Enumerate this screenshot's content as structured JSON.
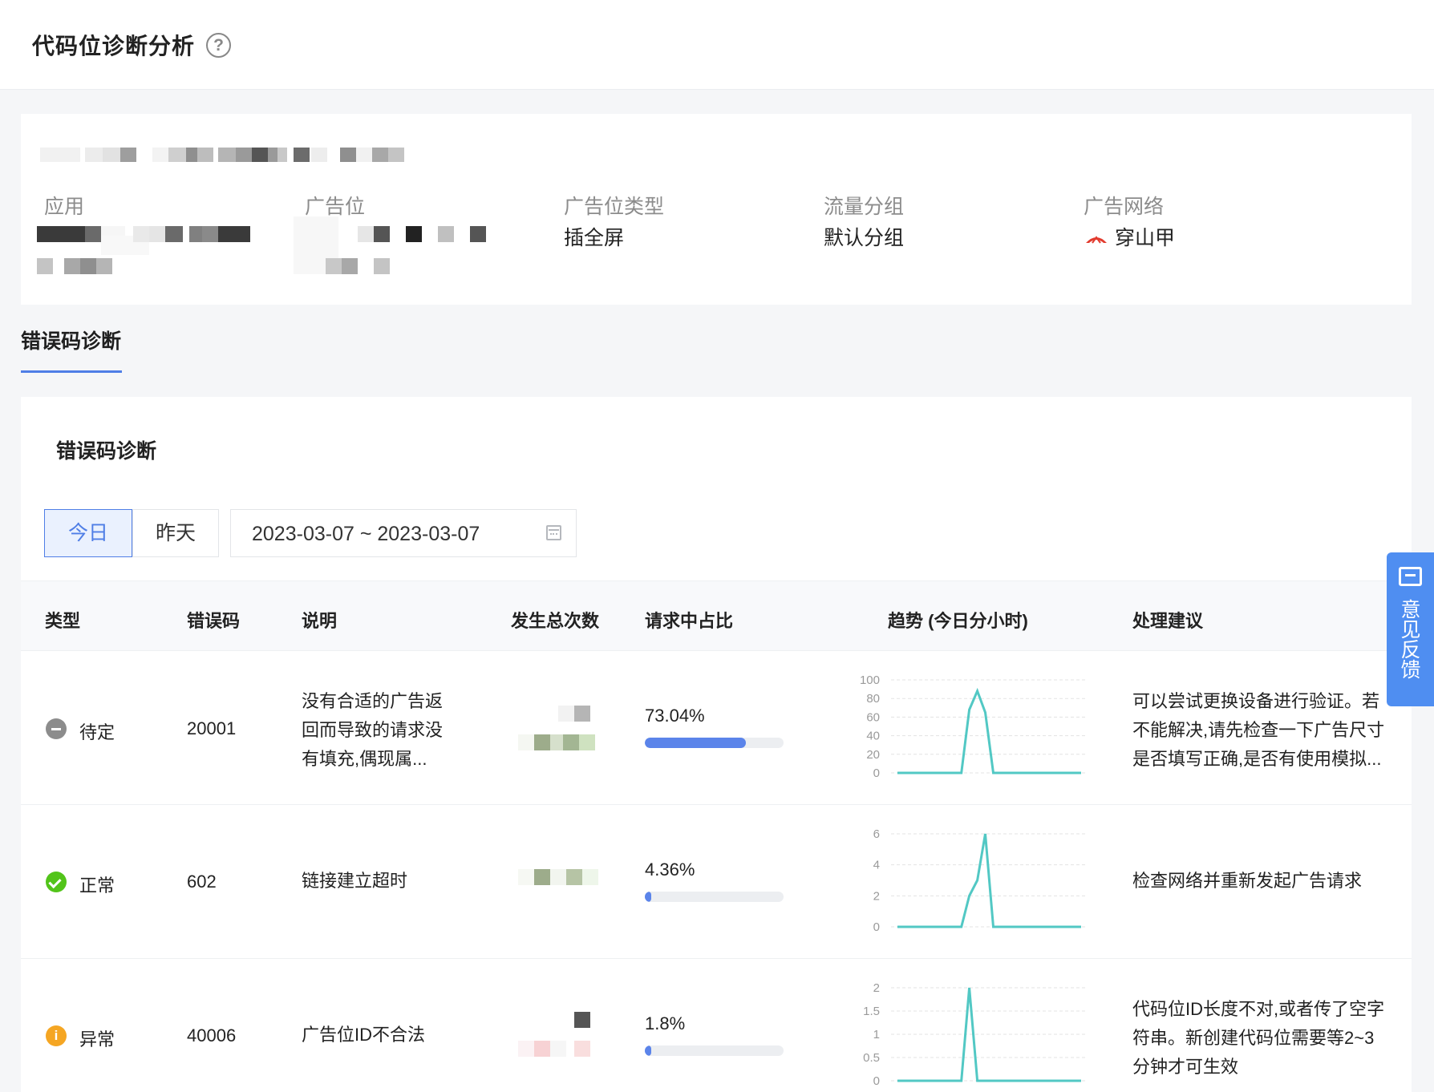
{
  "header": {
    "title": "代码位诊断分析",
    "help_icon": "help-circle-icon"
  },
  "info": {
    "fields": [
      {
        "label": "应用",
        "value": ""
      },
      {
        "label": "广告位",
        "value": ""
      },
      {
        "label": "广告位类型",
        "value": "插全屏"
      },
      {
        "label": "流量分组",
        "value": "默认分组"
      },
      {
        "label": "广告网络",
        "value": "穿山甲"
      }
    ]
  },
  "tabs": [
    {
      "label": "错误码诊断",
      "active": true
    }
  ],
  "section": {
    "title": "错误码诊断"
  },
  "filters": {
    "today": "今日",
    "yesterday": "昨天",
    "date_range": "2023-03-07 ~ 2023-03-07"
  },
  "table": {
    "headers": [
      "类型",
      "错误码",
      "说明",
      "发生总次数",
      "请求中占比",
      "趋势 (今日分小时)",
      "处理建议"
    ],
    "rows": [
      {
        "status": "待定",
        "status_icon": "minus-circle-icon",
        "code": "20001",
        "description": "没有合适的广告返回而导致的请求没有填充,偶现属...",
        "percent": "73.04%",
        "ratio": 0.7304,
        "trend": {
          "yticks": [
            "100",
            "80",
            "60",
            "40",
            "20",
            "0"
          ],
          "ymax": 100,
          "values": [
            0,
            0,
            0,
            0,
            0,
            0,
            0,
            0,
            0,
            68,
            88,
            65,
            0,
            0,
            0,
            0,
            0,
            0,
            0,
            0,
            0,
            0,
            0,
            0
          ]
        },
        "advice": "可以尝试更换设备进行验证。若不能解决,请先检查一下广告尺寸是否填写正确,是否有使用模拟..."
      },
      {
        "status": "正常",
        "status_icon": "check-circle-icon",
        "code": "602",
        "description": "链接建立超时",
        "percent": "4.36%",
        "ratio": 0.0436,
        "trend": {
          "yticks": [
            "6",
            "4",
            "2",
            "0"
          ],
          "ymax": 6,
          "values": [
            0,
            0,
            0,
            0,
            0,
            0,
            0,
            0,
            0,
            2,
            3,
            6,
            0,
            0,
            0,
            0,
            0,
            0,
            0,
            0,
            0,
            0,
            0,
            0
          ]
        },
        "advice": "检查网络并重新发起广告请求"
      },
      {
        "status": "异常",
        "status_icon": "info-circle-icon",
        "code": "40006",
        "description": "广告位ID不合法",
        "percent": "1.8%",
        "ratio": 0.018,
        "trend": {
          "yticks": [
            "2",
            "1.5",
            "1",
            "0.5",
            "0"
          ],
          "ymax": 2,
          "values": [
            0,
            0,
            0,
            0,
            0,
            0,
            0,
            0,
            0,
            2,
            0,
            0,
            0,
            0,
            0,
            0,
            0,
            0,
            0,
            0,
            0,
            0,
            0,
            0
          ]
        },
        "advice": "代码位ID长度不对,或者传了空字符串。新创建代码位需要等2~3分钟才可生效"
      }
    ]
  },
  "feedback": {
    "label": "意见反馈",
    "icon": "feedback-icon"
  },
  "colors": {
    "accent": "#4f7ee6",
    "line": "#52c8c4",
    "bar": "#5b84ea"
  }
}
